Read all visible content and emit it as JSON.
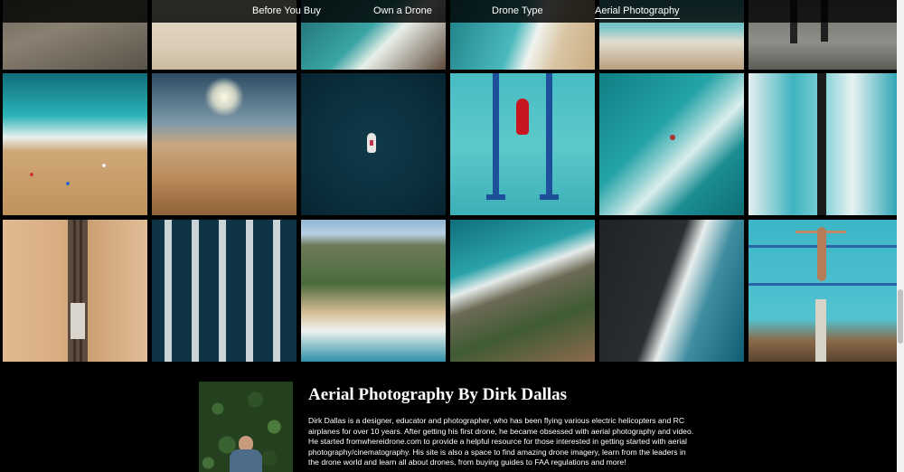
{
  "nav": {
    "items": [
      {
        "label": "Before You Buy",
        "active": false
      },
      {
        "label": "Own a Drone",
        "active": false
      },
      {
        "label": "Drone Type",
        "active": false
      },
      {
        "label": "Aerial Photography",
        "active": true
      }
    ]
  },
  "gallery": {
    "tiles": [
      {
        "name": "tile-top-1",
        "subject": "sand-texture"
      },
      {
        "name": "tile-top-2",
        "subject": "pale-sand"
      },
      {
        "name": "tile-top-3",
        "subject": "coast-rocks"
      },
      {
        "name": "tile-top-4",
        "subject": "beach-cove"
      },
      {
        "name": "tile-top-5",
        "subject": "shoreline"
      },
      {
        "name": "tile-top-6",
        "subject": "people-on-rocks"
      },
      {
        "name": "tile-mid-1",
        "subject": "beach-waves"
      },
      {
        "name": "tile-mid-2",
        "subject": "desert-dunes-sun"
      },
      {
        "name": "tile-mid-3",
        "subject": "boat-on-dark-sea"
      },
      {
        "name": "tile-mid-4",
        "subject": "swimmer-red-dress-pool"
      },
      {
        "name": "tile-mid-5",
        "subject": "surfer-in-surf"
      },
      {
        "name": "tile-mid-6",
        "subject": "ocean-pool-edge"
      },
      {
        "name": "tile-bot-1",
        "subject": "railway-through-sand"
      },
      {
        "name": "tile-bot-2",
        "subject": "marina-boats"
      },
      {
        "name": "tile-bot-3",
        "subject": "coastal-town-beach"
      },
      {
        "name": "tile-bot-4",
        "subject": "rocky-cove"
      },
      {
        "name": "tile-bot-5",
        "subject": "black-sand-beach"
      },
      {
        "name": "tile-bot-6",
        "subject": "diver-pool-platform"
      }
    ]
  },
  "bio": {
    "title": "Aerial Photography By Dirk Dallas",
    "text": "Dirk Dallas is a designer, educator and photographer, who has been flying various electric helicopters and RC airplanes for over 10 years. After getting his first drone, he became obsessed with aerial photography and video. He started fromwhereidrone.com to provide a helpful resource for those interested in getting started with aerial photography/cinematography. His site is also a space to find amazing drone imagery, learn from the leaders in the drone world and learn all about drones, from buying guides to FAA regulations and more!"
  }
}
